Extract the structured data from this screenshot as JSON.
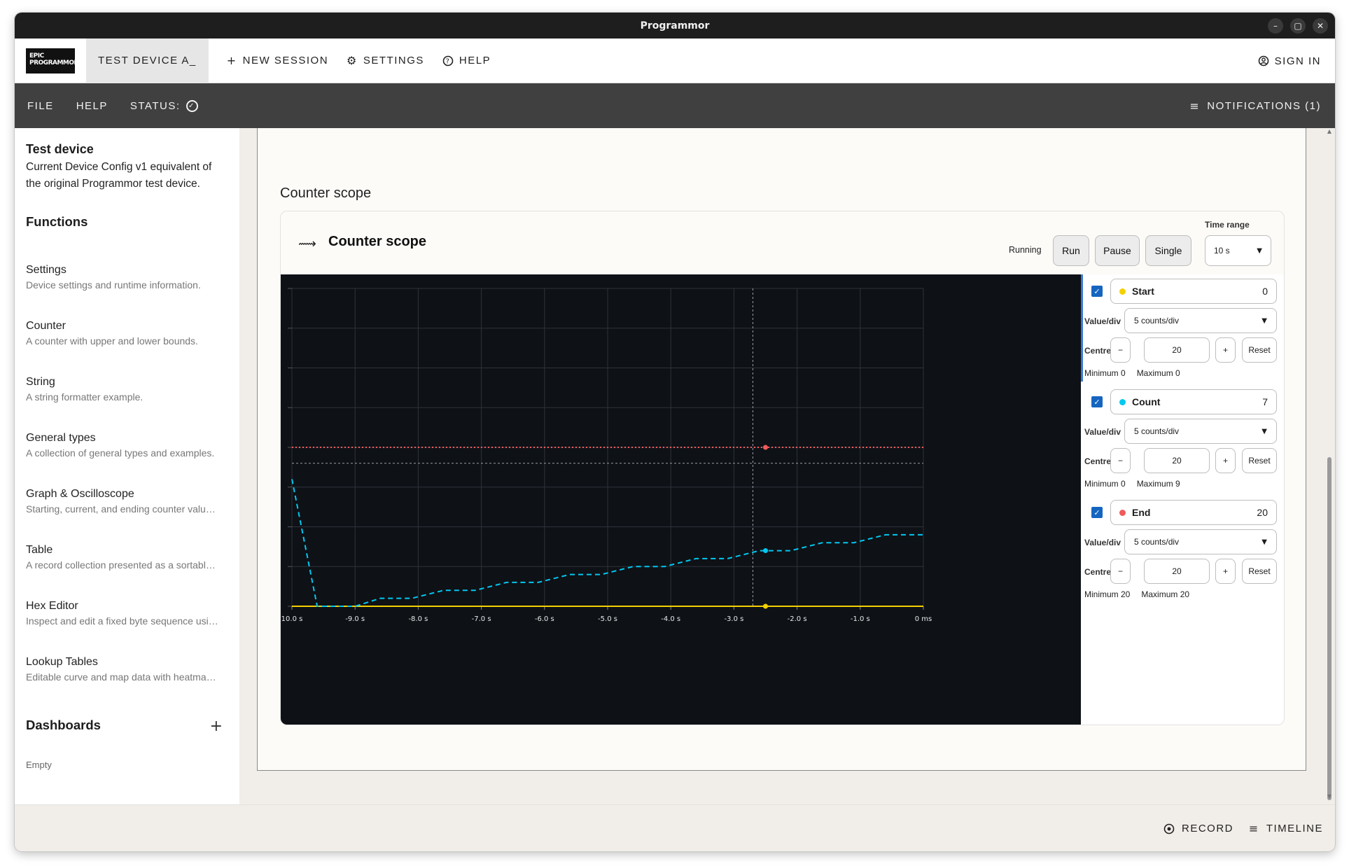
{
  "window": {
    "title": "Programmor",
    "controls": [
      "–",
      "▢",
      "✕"
    ]
  },
  "appbar": {
    "logo_line1": "EPIC",
    "logo_line2": "PROGRAMMOR",
    "device_tab": "TEST DEVICE A_",
    "new_session": "NEW SESSION",
    "settings": "SETTINGS",
    "help": "HELP",
    "sign_in": "SIGN IN"
  },
  "menubar": {
    "file": "FILE",
    "help": "HELP",
    "status": "STATUS:",
    "notifications": "NOTIFICATIONS (1)"
  },
  "sidebar": {
    "device_title": "Test device",
    "device_desc": "Current Device Config v1 equivalent of the original Programmor test device.",
    "functions_heading": "Functions",
    "functions": [
      {
        "name": "Settings",
        "desc": "Device settings and runtime information."
      },
      {
        "name": "Counter",
        "desc": "A counter with upper and lower bounds."
      },
      {
        "name": "String",
        "desc": "A string formatter example."
      },
      {
        "name": "General types",
        "desc": "A collection of general types and examples."
      },
      {
        "name": "Graph & Oscilloscope",
        "desc": "Starting, current, and ending counter valu…"
      },
      {
        "name": "Table",
        "desc": "A record collection presented as a sortabl…"
      },
      {
        "name": "Hex Editor",
        "desc": "Inspect and edit a fixed byte sequence usi…"
      },
      {
        "name": "Lookup Tables",
        "desc": "Editable curve and map data with heatma…"
      }
    ],
    "dashboards_heading": "Dashboards",
    "dashboards_empty": "Empty"
  },
  "main": {
    "section_label": "Counter scope",
    "card_title": "Counter scope",
    "state": "Running",
    "run": "Run",
    "pause": "Pause",
    "single": "Single",
    "time_range_label": "Time range",
    "time_range_value": "10 s"
  },
  "channels": [
    {
      "name": "Start",
      "value": "0",
      "color": "#f5d000",
      "value_div": "5 counts/div",
      "centre": "20",
      "min": "Minimum 0",
      "max": "Maximum 0"
    },
    {
      "name": "Count",
      "value": "7",
      "color": "#00c8f0",
      "value_div": "5 counts/div",
      "centre": "20",
      "min": "Minimum 0",
      "max": "Maximum 9"
    },
    {
      "name": "End",
      "value": "20",
      "color": "#f05a5a",
      "value_div": "5 counts/div",
      "centre": "20",
      "min": "Minimum 20",
      "max": "Maximum 20"
    }
  ],
  "channel_labels": {
    "value_div": "Value/div",
    "centre": "Centre",
    "minus": "−",
    "plus": "+",
    "reset": "Reset"
  },
  "chart_data": {
    "type": "line",
    "x_ticks": [
      "10.0 s",
      "-9.0 s",
      "-8.0 s",
      "-7.0 s",
      "-6.0 s",
      "-5.0 s",
      "-4.0 s",
      "-3.0 s",
      "-2.0 s",
      "-1.0 s",
      "0 ms"
    ],
    "xlim": [
      -10,
      0
    ],
    "ylim": [
      0,
      40
    ],
    "grid": true,
    "cursor_x": -2.7,
    "series": [
      {
        "name": "Start",
        "color": "#f5d000",
        "style": "solid",
        "points": [
          [
            -10,
            0
          ],
          [
            0,
            0
          ]
        ]
      },
      {
        "name": "End",
        "color": "#f05a5a",
        "style": "dotted",
        "points": [
          [
            -10,
            20
          ],
          [
            0,
            20
          ]
        ]
      },
      {
        "name": "Count",
        "color": "#00c8f0",
        "style": "dashed",
        "points": [
          [
            -10,
            16
          ],
          [
            -9.6,
            0
          ],
          [
            -9.0,
            0
          ],
          [
            -8.6,
            1
          ],
          [
            -8.1,
            1
          ],
          [
            -7.6,
            2
          ],
          [
            -7.1,
            2
          ],
          [
            -6.6,
            3
          ],
          [
            -6.1,
            3
          ],
          [
            -5.6,
            4
          ],
          [
            -5.1,
            4
          ],
          [
            -4.6,
            5
          ],
          [
            -4.1,
            5
          ],
          [
            -3.6,
            6
          ],
          [
            -3.1,
            6
          ],
          [
            -2.6,
            7
          ],
          [
            -2.1,
            7
          ],
          [
            -1.6,
            8
          ],
          [
            -1.1,
            8
          ],
          [
            -0.6,
            9
          ],
          [
            0,
            9
          ]
        ]
      }
    ],
    "markers": [
      {
        "series": "End",
        "x": -2.5,
        "y": 20
      },
      {
        "series": "Count",
        "x": -2.5,
        "y": 7
      },
      {
        "series": "Start",
        "x": -2.5,
        "y": 0
      }
    ]
  }
}
